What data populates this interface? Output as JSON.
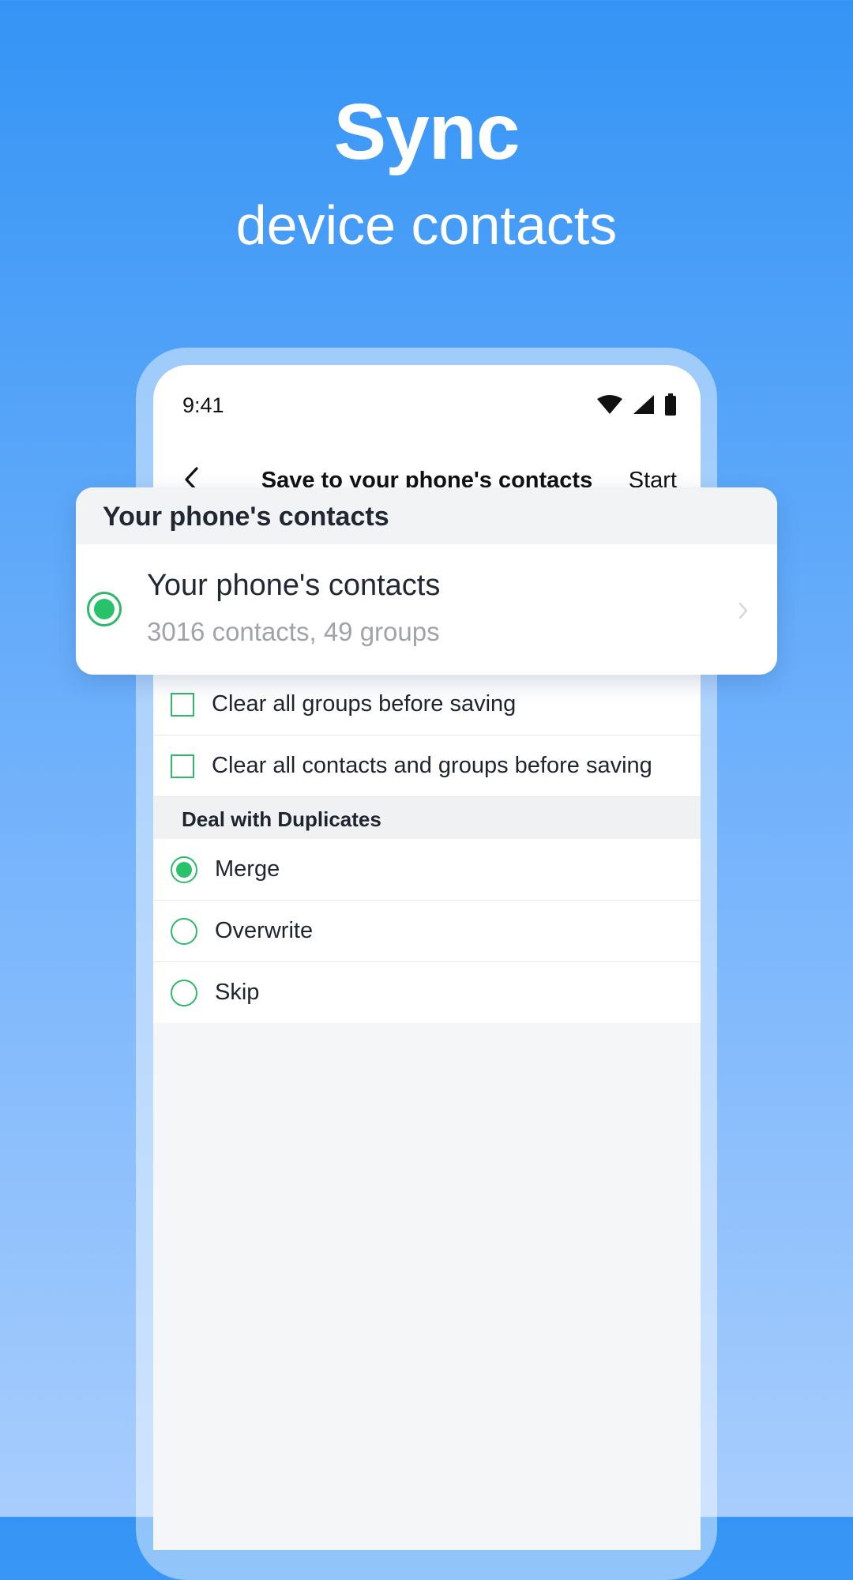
{
  "hero": {
    "title": "Sync",
    "subtitle": "device contacts"
  },
  "status_bar": {
    "time": "9:41",
    "icons": [
      "wifi-icon",
      "signal-icon",
      "battery-icon"
    ]
  },
  "nav": {
    "back_icon": "chevron-left-icon",
    "title": "Save to your phone's contacts",
    "action": "Start"
  },
  "popup": {
    "header": "Your phone's contacts",
    "item_title": "Your phone's contacts",
    "item_subtitle": "3016 contacts, 49 groups",
    "selected": true
  },
  "options": {
    "clear_groups": {
      "label": "Clear all groups before saving",
      "checked": false
    },
    "clear_all": {
      "label": "Clear all contacts and groups before saving",
      "checked": false
    }
  },
  "duplicates": {
    "header": "Deal with Duplicates",
    "items": [
      {
        "label": "Merge",
        "selected": true
      },
      {
        "label": "Overwrite",
        "selected": false
      },
      {
        "label": "Skip",
        "selected": false
      }
    ]
  },
  "colors": {
    "accent_green": "#27c26a",
    "background_top": "#3494f5",
    "background_bottom": "#a8cdfd"
  }
}
